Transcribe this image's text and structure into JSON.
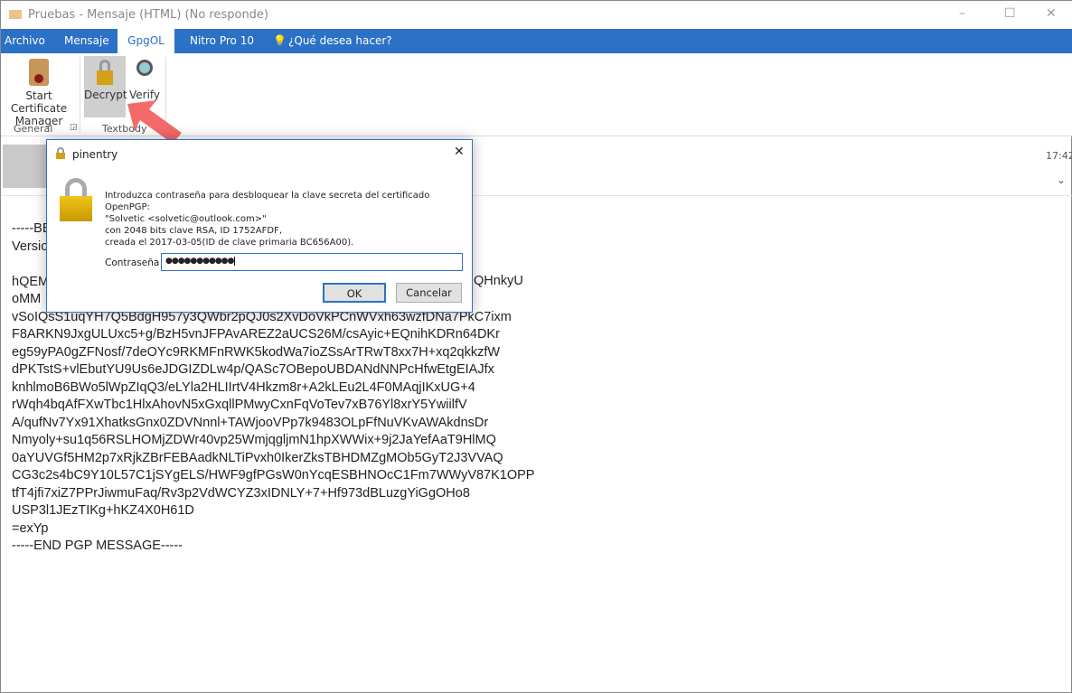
{
  "window": {
    "title": "Pruebas - Mensaje (HTML)  (No responde)",
    "min": "–",
    "max": "☐",
    "close": "✕"
  },
  "tabs": [
    {
      "label": "Archivo"
    },
    {
      "label": "Mensaje"
    },
    {
      "label": "GpgOL"
    },
    {
      "label": "Nitro Pro 10"
    },
    {
      "label": "¿Qué desea hacer?"
    }
  ],
  "ribbon": {
    "start_cert": "Start Certificate Manager",
    "decrypt": "Decrypt",
    "verify": "Verify",
    "group_general": "General",
    "group_textbody": "Textbody"
  },
  "header": {
    "time": "17:42"
  },
  "message": {
    "lines": [
      "-----BE",
      "Versio",
      "",
      "hQEM",
      "oMM",
      "vSoIQsS1uqYH7Q5BdgH957y3QWbr2pQJ0s2XvDoVkPCnWVxh63wzfDNa7PkC7ixm",
      "F8ARKN9JxgULUxc5+g/BzH5vnJFPAvAREZ2aUCS26M/csAyic+EQnihKDRn64DKr",
      "eg59yPA0gZFNosf/7deOYc9RKMFnRWK5kodWa7ioZSsArTRwT8xx7H+xq2qkkzfW",
      "dPKTstS+vlEbutYU9Us6eJDGIZDLw4p/QASc7OBepoUBDANdNNPcHfwEtgEIAJfx",
      "knhlmoB6BWo5lWpZIqQ3/eLYla2HLIIrtV4Hkzm8r+A2kLEu2L4F0MAqjIKxUG+4",
      "rWqh4bqAfFXwTbc1HlxAhovN5xGxqllPMwyCxnFqVoTev7xB76Yl8xrY5YwiilfV",
      "A/qufNv7Yx91XhatksGnx0ZDVNnnl+TAWjooVPp7k9483OLpFfNuVKvAWAkdnsDr",
      "Nmyoly+su1q56RSLHOMjZDWr40vp25WmjqgljmN1hpXWWix+9j2JaYefAaT9HlMQ",
      "0aYUVGf5HM2p7xRjkZBrFEBAadkNLTiPvxh0IkerZksTBHDMZgMOb5GyT2J3VVAQ",
      "CG3c2s4bC9Y10L57C1jSYgELS/HWF9gfPGsW0nYcqESBHNOcC1Fm7WWyV87K1OPP",
      "tfT4jfi7xiZ7PPrJiwmuFaq/Rv3p2VdWCYZ3xIDNLY+7+Hf973dBLuzgYiGgOHo8",
      "USP3l1JEzTIKg+hKZ4X0H61D",
      "=exYp",
      "-----END PGP MESSAGE-----"
    ],
    "line3_tail": "QHnkyU"
  },
  "dialog": {
    "title": "pinentry",
    "prompt": [
      "Introduzca contraseña para desbloquear la clave secreta del certificado OpenPGP:",
      "\"Solvetic <solvetic@outlook.com>\"",
      "con 2048 bits clave RSA, ID 1752AFDF,",
      "creada el 2017-03-05(ID de clave primaria BC656A00)."
    ],
    "password_label": "Contraseña",
    "password_value": "●●●●●●●●●●●",
    "ok": "OK",
    "cancel": "Cancelar",
    "close": "✕"
  },
  "colors": {
    "accent": "#2b71c6",
    "arrow": "#f46a6a"
  }
}
